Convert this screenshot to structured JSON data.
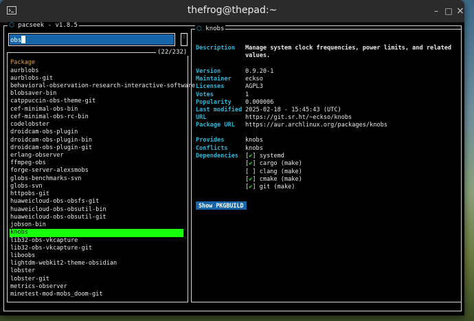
{
  "window": {
    "title": "thefrog@thepad:~",
    "minimize": "–",
    "maximize": "□",
    "close": "×"
  },
  "app": {
    "title": "pacseek - v1.8.5"
  },
  "search": {
    "value": "obs",
    "options_glyph": "⋮"
  },
  "results": {
    "count": "(22/232)",
    "header": "Package",
    "items": [
      "aurblobs",
      "aurblobs-git",
      "behavioral-observation-research-interactive-software",
      "blobsaver-bin",
      "catppuccin-obs-theme-git",
      "cef-minimal-obs-bin",
      "cef-minimal-obs-rc-bin",
      "codelobster",
      "droidcam-obs-plugin",
      "droidcam-obs-plugin-bin",
      "droidcam-obs-plugin-git",
      "erlang-observer",
      "ffmpeg-obs",
      "forge-server-alexsmobs",
      "globs-benchmarks-svn",
      "globs-svn",
      "httpobs-git",
      "huaweicloud-obs-obsfs-git",
      "huaweicloud-obs-obsutil-bin",
      "huaweicloud-obs-obsutil-git",
      "jobson-bin",
      "knobs",
      "lib32-obs-vkcapture",
      "lib32-obs-vkcapture-git",
      "liboobs",
      "lightdm-webkit2-theme-obsidian",
      "lobster",
      "lobster-git",
      "metrics-observer",
      "minetest-mod-mobs_doom-git"
    ],
    "selected": "knobs"
  },
  "details": {
    "title": "knobs",
    "description_label": "Description",
    "description_line1": "Manage system clock frequencies, power limits, and related",
    "description_line2": "values.",
    "fields": [
      {
        "label": "Version",
        "value": "0.9.20-1"
      },
      {
        "label": "Maintainer",
        "value": "eckso"
      },
      {
        "label": "Licenses",
        "value": "AGPL3"
      },
      {
        "label": "Votes",
        "value": "1"
      },
      {
        "label": "Popularity",
        "value": "0.000006"
      },
      {
        "label": "Last modified",
        "value": "2025-02-18 - 15:45:43 (UTC)"
      },
      {
        "label": "URL",
        "value": "https://git.sr.ht/~eckso/knobs"
      },
      {
        "label": "Package URL",
        "value": "https://aur.archlinux.org/packages/knobs"
      }
    ],
    "provides_label": "Provides",
    "provides": "knobs",
    "conflicts_label": "Conflicts",
    "conflicts": "knobs",
    "dependencies_label": "Dependencies",
    "dependencies": [
      {
        "installed": true,
        "name": "systemd"
      },
      {
        "installed": true,
        "name": "cargo (make)"
      },
      {
        "installed": false,
        "name": "clang (make)"
      },
      {
        "installed": true,
        "name": "cmake (make)"
      },
      {
        "installed": true,
        "name": "git (make)"
      }
    ],
    "button": "Show PKGBUILD"
  },
  "colors": {
    "accent": "#2fb5d8",
    "selection": "#18ff0c",
    "header": "#e0a53b",
    "input_bg": "#1565a8"
  }
}
